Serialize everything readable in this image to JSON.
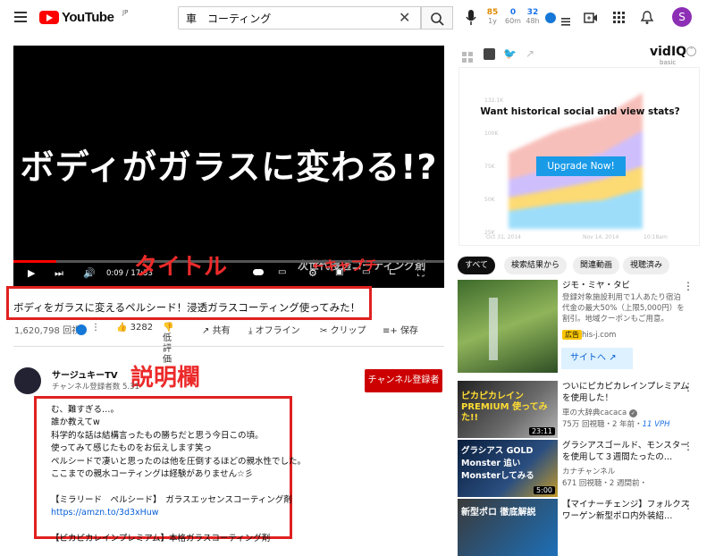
{
  "header": {
    "logo_text": "YouTube",
    "region": "JP",
    "search_value": "車　コーティング",
    "vidiq_stats": {
      "v1": "85",
      "v2": "0",
      "v3": "32",
      "l1": "1y",
      "l2": "60m",
      "l3": "48h"
    },
    "avatar_letter": "S"
  },
  "player": {
    "overlay_text": "ボディがガラスに変わる!?",
    "time": "0:09 / 17:33",
    "watermark": "次世代浸透コーティング剤"
  },
  "annotations": {
    "title_label": "タイトル",
    "desc_label": "説明欄",
    "partial_label": "←キャプチ"
  },
  "video": {
    "title": "ボディをガラスに変えるペルシード！浸透ガラスコーティング使ってみた！",
    "views": "1,620,798 回視",
    "likes": "3282",
    "rate_label": "低評価",
    "share": "共有",
    "offline": "オフライン",
    "clip": "クリップ",
    "save": "保存"
  },
  "channel": {
    "name": "サージュキーTV",
    "subs": "チャンネル登録者数 5.31",
    "subscribe": "チャンネル登録者"
  },
  "description": {
    "lines": [
      "む、難すぎる…。",
      "誰か教えてw",
      "科学的な話は結構言ったもの勝ちだと思う今日この頃。",
      "使ってみて感じたものをお伝えします笑っ",
      "ペルシードで凄いと思ったのは他を圧倒するほどの親水性でした。",
      "ここまでの親水コーティングは経験がありません☆彡",
      "",
      "【ミラリード　ペルシード】　ガラスエッセンスコーティング剤",
      "https://amzn.to/3d3xHuw",
      "",
      "【ピカピカレインプレミアム】本格ガラスコーティング剤"
    ]
  },
  "vidiq": {
    "brand": "vidIQ",
    "tier": "basic",
    "headline": "Want historical social and view stats?",
    "cta": "Upgrade Now!",
    "ylabels": [
      "132.1K",
      "100K",
      "75K",
      "50K",
      "25K"
    ],
    "xlabels": [
      "Oct 31, 2014",
      "Nov 14, 2014",
      "10:18am"
    ]
  },
  "chips": [
    "すべて",
    "検索結果から",
    "関連動画",
    "視聴済み"
  ],
  "ad": {
    "title": "ジモ・ミヤ・タビ",
    "body": "登録対象施設利用で1人あたり宿泊代金の最大50%（上限5,000円）を割引。地域クーポンもご用意。",
    "badge": "広告",
    "domain": "his-j.com",
    "button": "サイトへ"
  },
  "recs": [
    {
      "title": "ついにピカピカレインプレミアムを使用した！",
      "channel": "車の大辞典cacaca",
      "stats": "75万 回視聴・2 年前・",
      "vph": "11 VPH",
      "duration": "23:11",
      "thumb_text": "ピカピカレイン PREMIUM 使ってみた!!"
    },
    {
      "title": "グラシアスゴールド、モンスターを使用して３週間たったの…",
      "channel": "カナチャンネル",
      "stats": "671 回視聴・2 週間前・",
      "vph": "",
      "duration": "5:00",
      "thumb_text": "グラシアス GOLD Monster 追いMonsterしてみる"
    },
    {
      "title": "【マイナーチェンジ】フォルクスワーゲン新型ポロ内外装紹…",
      "channel": "",
      "stats": "",
      "vph": "",
      "duration": "",
      "thumb_text": "新型ポロ 徹底解説"
    }
  ]
}
